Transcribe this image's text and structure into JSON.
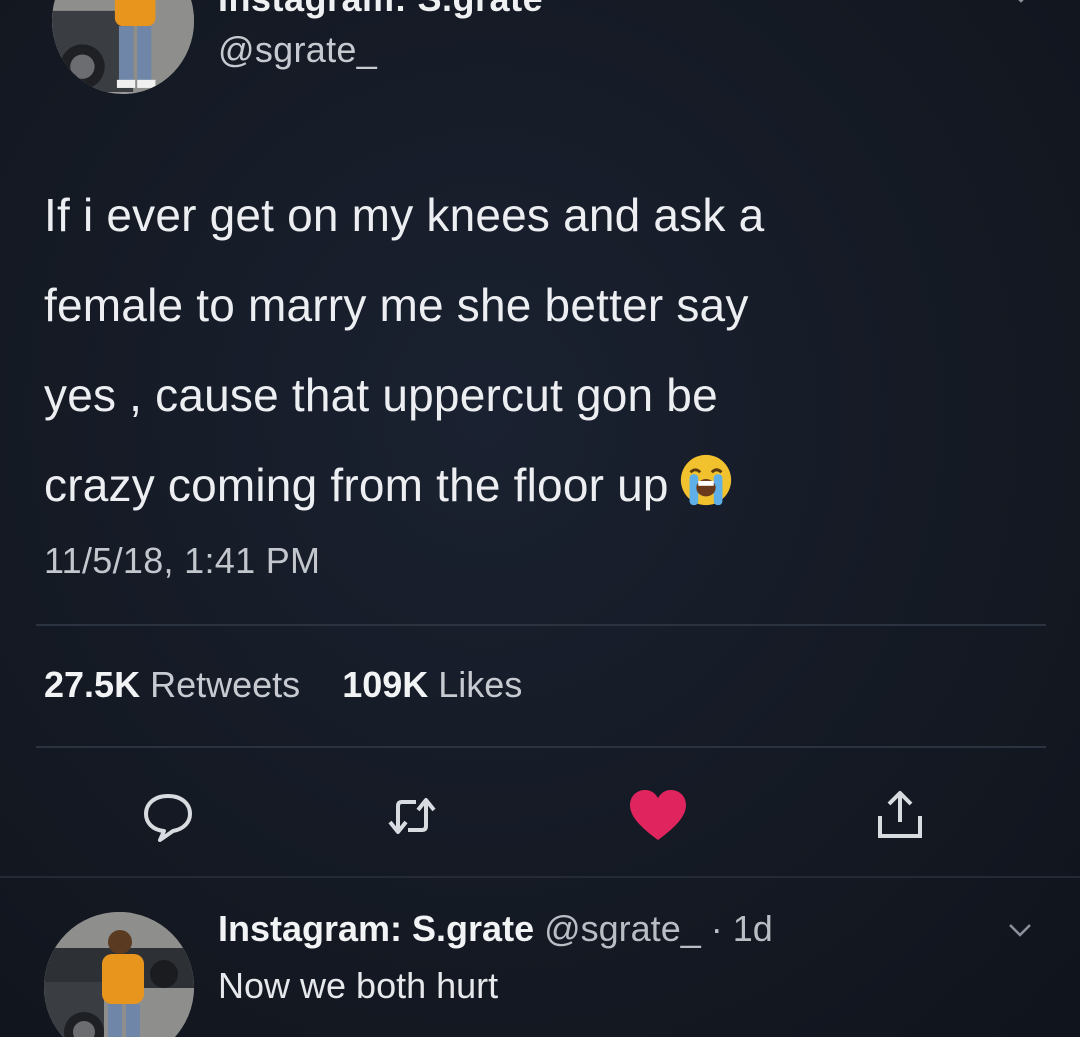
{
  "top_tweet": {
    "display_name": "Instagram: S.grate",
    "handle": "@sgrate_",
    "text_lines": [
      "If i ever get on my knees and ask a",
      "female to marry me she better say",
      "yes , cause that uppercut gon be",
      "crazy coming from the floor up"
    ],
    "emoji": "loudly-crying-face",
    "timestamp": "11/5/18, 1:41 PM",
    "retweets_count": "27.5K",
    "retweets_label": "Retweets",
    "likes_count": "109K",
    "likes_label": "Likes",
    "liked": true
  },
  "actions": [
    {
      "name": "reply",
      "icon": "speech-bubble-icon"
    },
    {
      "name": "retweet",
      "icon": "retweet-icon"
    },
    {
      "name": "like",
      "icon": "heart-icon",
      "color": "#e0245e"
    },
    {
      "name": "share",
      "icon": "share-icon"
    }
  ],
  "reply": {
    "display_name": "Instagram: S.grate",
    "meta": "@sgrate_ · 1d",
    "text": "Now we both hurt"
  },
  "colors": {
    "background": "#141923",
    "like_active": "#e0245e",
    "divider": "#2c3340"
  }
}
